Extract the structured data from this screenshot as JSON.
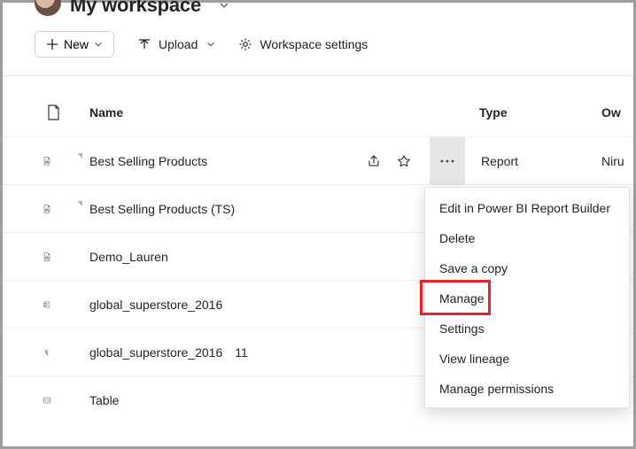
{
  "header": {
    "workspace_name": "My workspace"
  },
  "toolbar": {
    "new_label": "New",
    "upload_label": "Upload",
    "settings_label": "Workspace settings"
  },
  "columns": {
    "name": "Name",
    "type": "Type",
    "owner": "Ow"
  },
  "rows": [
    {
      "name": "Best Selling Products",
      "suffix": "",
      "type": "Report",
      "owner": "Niru",
      "icon": "paginated",
      "marker": true,
      "hover": true
    },
    {
      "name": "Best Selling Products (TS)",
      "suffix": "",
      "type": "",
      "owner": "",
      "icon": "paginated",
      "marker": true,
      "hover": false
    },
    {
      "name": "Demo_Lauren",
      "suffix": "",
      "type": "",
      "owner": "",
      "icon": "paginated",
      "marker": false,
      "hover": false
    },
    {
      "name": "global_superstore_2016",
      "suffix": "",
      "type": "",
      "owner": "",
      "icon": "workbook",
      "marker": false,
      "hover": false
    },
    {
      "name": "global_superstore_2016",
      "suffix": "11",
      "type": "",
      "owner": "",
      "icon": "dataflow",
      "marker": false,
      "hover": false
    },
    {
      "name": "Table",
      "suffix": "",
      "type": "",
      "owner": "",
      "icon": "table",
      "marker": false,
      "hover": false
    }
  ],
  "menu": {
    "items": [
      "Edit in Power BI Report Builder",
      "Delete",
      "Save a copy",
      "Manage",
      "Settings",
      "View lineage",
      "Manage permissions"
    ],
    "highlight_index": 3
  }
}
